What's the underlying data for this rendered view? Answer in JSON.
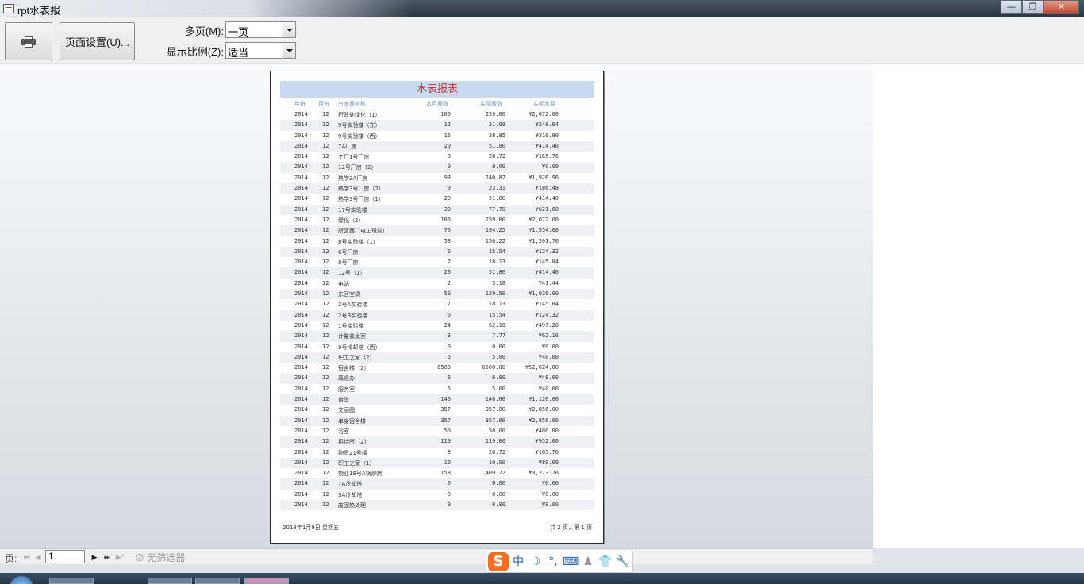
{
  "window": {
    "title": "rpt水表报",
    "min": "—",
    "max": "❐",
    "close": "✕"
  },
  "toolbar": {
    "print_label": "",
    "page_setup_label": "页面设置(U)...",
    "multi_page_label": "多页(M):",
    "multi_page_value": "一页",
    "zoom_label": "显示比例(Z):",
    "zoom_value": "适当"
  },
  "report": {
    "title": "水表报表",
    "headers": [
      "年份",
      "月份",
      "分水表名称",
      "本月表数",
      "实际表数",
      "实际水费"
    ],
    "rows": [
      [
        "2014",
        "12",
        "行政处绿化（1）",
        "100",
        "259.00",
        "¥2,072.00"
      ],
      [
        "2014",
        "12",
        "9号实验楼（东）",
        "12",
        "31.08",
        "¥248.64"
      ],
      [
        "2014",
        "12",
        "9号实验楼（西）",
        "15",
        "38.85",
        "¥310.80"
      ],
      [
        "2014",
        "12",
        "7A厂房",
        "20",
        "51.80",
        "¥414.40"
      ],
      [
        "2014",
        "12",
        "工厂1号厂房",
        "8",
        "20.72",
        "¥165.76"
      ],
      [
        "2014",
        "12",
        "12号厂房（2）",
        "0",
        "0.00",
        "¥0.00"
      ],
      [
        "2014",
        "12",
        "热学3A厂房",
        "93",
        "240.87",
        "¥1,926.96"
      ],
      [
        "2014",
        "12",
        "热学3号厂房（2）",
        "9",
        "23.31",
        "¥186.48"
      ],
      [
        "2014",
        "12",
        "热学3号厂房（1）",
        "20",
        "51.80",
        "¥414.40"
      ],
      [
        "2014",
        "12",
        "17号实验楼",
        "30",
        "77.70",
        "¥621.60"
      ],
      [
        "2014",
        "12",
        "绿化（2）",
        "100",
        "259.00",
        "¥2,072.00"
      ],
      [
        "2014",
        "12",
        "所区西（电工班前）",
        "75",
        "194.25",
        "¥1,554.00"
      ],
      [
        "2014",
        "12",
        "8号实验楼（1）",
        "58",
        "150.22",
        "¥1,201.76"
      ],
      [
        "2014",
        "12",
        "6号厂房",
        "6",
        "15.54",
        "¥124.32"
      ],
      [
        "2014",
        "12",
        "8号厂房",
        "7",
        "18.13",
        "¥145.04"
      ],
      [
        "2014",
        "12",
        "12号（1）",
        "20",
        "51.80",
        "¥414.40"
      ],
      [
        "2014",
        "12",
        "电站",
        "2",
        "5.18",
        "¥41.44"
      ],
      [
        "2014",
        "12",
        "东区空调",
        "50",
        "129.50",
        "¥1,036.00"
      ],
      [
        "2014",
        "12",
        "2号A实验楼",
        "7",
        "18.13",
        "¥145.04"
      ],
      [
        "2014",
        "12",
        "2号B实验楼",
        "6",
        "15.54",
        "¥124.32"
      ],
      [
        "2014",
        "12",
        "1号实验楼",
        "24",
        "62.16",
        "¥497.28"
      ],
      [
        "2014",
        "12",
        "计量收发室",
        "3",
        "7.77",
        "¥62.16"
      ],
      [
        "2014",
        "12",
        "9号冷却塔（西）",
        "0",
        "0.00",
        "¥0.00"
      ],
      [
        "2014",
        "12",
        "职工之家（2）",
        "5",
        "5.00",
        "¥40.00"
      ],
      [
        "2014",
        "12",
        "宿舍楼（2）",
        "6500",
        "6500.00",
        "¥52,024.00"
      ],
      [
        "2014",
        "12",
        "离退办",
        "6",
        "6.00",
        "¥48.00"
      ],
      [
        "2014",
        "12",
        "服务室",
        "5",
        "5.00",
        "¥40.00"
      ],
      [
        "2014",
        "12",
        "食堂",
        "140",
        "140.00",
        "¥1,120.00"
      ],
      [
        "2014",
        "12",
        "文丽园",
        "357",
        "357.00",
        "¥2,856.00"
      ],
      [
        "2014",
        "12",
        "单身宿舍楼",
        "357",
        "357.00",
        "¥2,856.00"
      ],
      [
        "2014",
        "12",
        "浴室",
        "50",
        "50.00",
        "¥400.00"
      ],
      [
        "2014",
        "12",
        "招待所（2）",
        "119",
        "119.00",
        "¥952.00"
      ],
      [
        "2014",
        "12",
        "物资21号楼",
        "8",
        "20.72",
        "¥165.76"
      ],
      [
        "2014",
        "12",
        "职工之家（1）",
        "10",
        "10.00",
        "¥80.00"
      ],
      [
        "2014",
        "12",
        "物业18号A锅炉房",
        "158",
        "409.22",
        "¥3,273.76"
      ],
      [
        "2014",
        "12",
        "7A冷却塔",
        "0",
        "0.00",
        "¥0.00"
      ],
      [
        "2014",
        "12",
        "3A冷却塔",
        "0",
        "0.00",
        "¥0.00"
      ],
      [
        "2014",
        "12",
        "废固热处理",
        "0",
        "0.00",
        "¥0.00"
      ]
    ],
    "footer_date": "2018年1月9日 星期五",
    "footer_page": "共 2 页，第 1 页"
  },
  "statusbar": {
    "page_label": "页:",
    "page_value": "1",
    "filter_label": "无筛选器"
  },
  "ime": {
    "logo": "S",
    "mode": "中"
  }
}
